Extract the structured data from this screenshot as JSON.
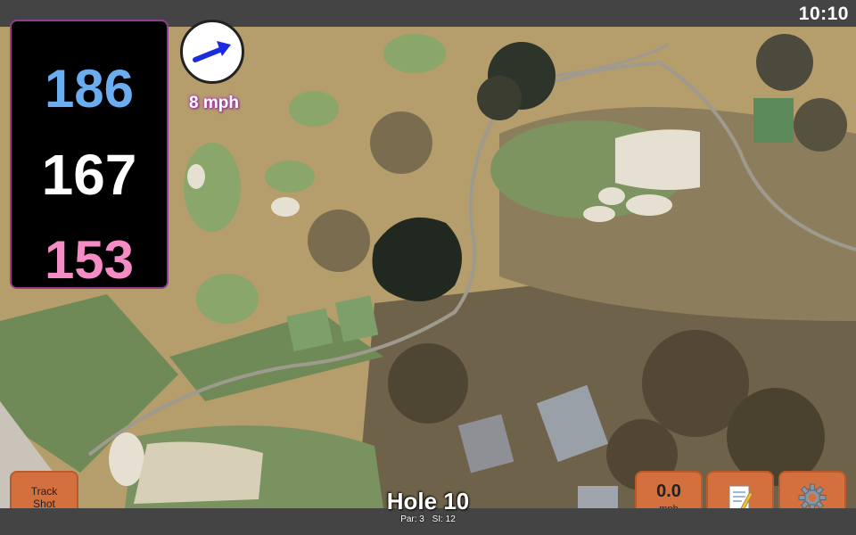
{
  "status_bar": {
    "time": "10:10"
  },
  "distances": {
    "back": "186",
    "middle": "167",
    "front": "153"
  },
  "colors": {
    "back": "#6aaef0",
    "middle": "#ffffff",
    "front": "#f58cc6",
    "button": "#d4703e",
    "wind_arrow": "#1b2be0"
  },
  "wind": {
    "speed_label": "8 mph",
    "icon": "wind-direction-arrow-icon"
  },
  "buttons": {
    "track_shot": "Track\nShot",
    "speed_value": "0.0",
    "speed_unit": "mph",
    "notes_icon": "notepad-icon",
    "settings_icon": "gear-icon"
  },
  "hole": {
    "title": "Hole 10",
    "par": "Par: 3",
    "si": "SI: 12"
  }
}
